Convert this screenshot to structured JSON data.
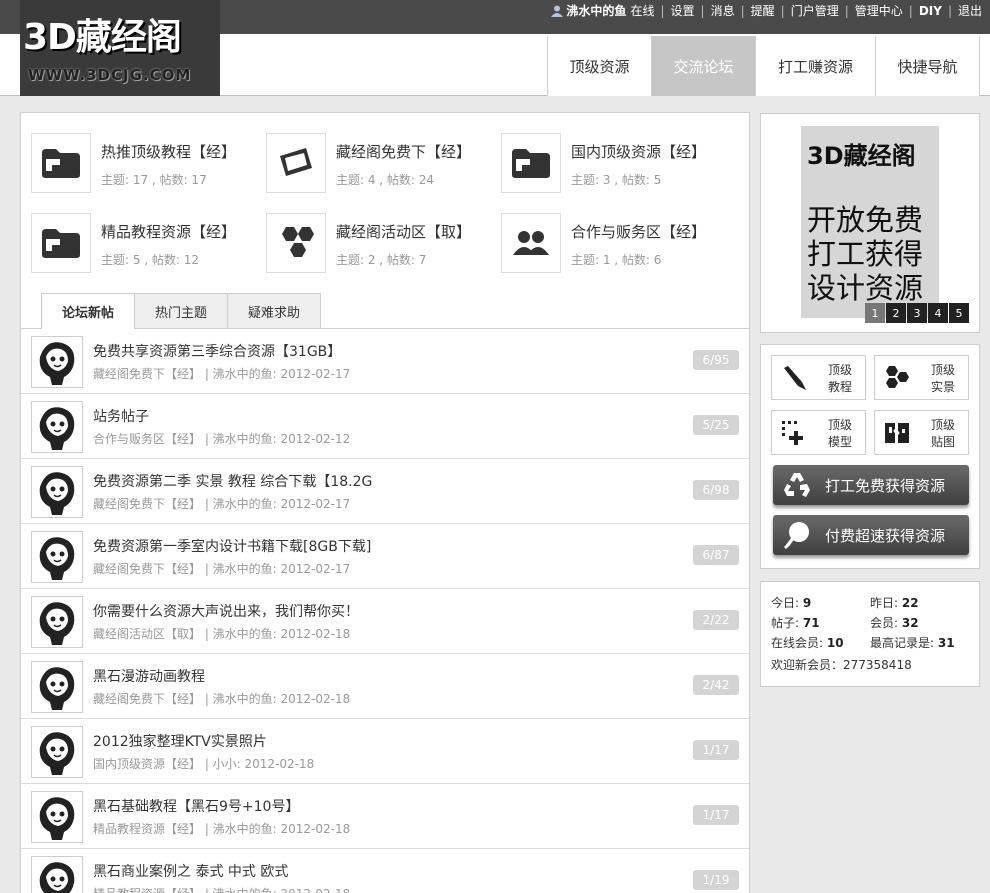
{
  "topbar": {
    "username": "沸水中的鱼",
    "status": "在线",
    "links": [
      "设置",
      "消息",
      "提醒",
      "门户管理",
      "管理中心",
      "DIY",
      "退出"
    ]
  },
  "logo": {
    "main": "3D藏经阁",
    "sub": "WWW.3DCJG.COM"
  },
  "nav": {
    "items": [
      "顶级资源",
      "交流论坛",
      "打工赚资源",
      "快捷导航"
    ],
    "active": "交流论坛"
  },
  "forums": [
    {
      "name": "热推顶级教程【经】",
      "stat": "主题: 17 , 帖数: 17",
      "icon": "folder-icon"
    },
    {
      "name": "藏经阁免费下【经】",
      "stat": "主题: 4 , 帖数: 24",
      "icon": "frames-icon"
    },
    {
      "name": "国内顶级资源【经】",
      "stat": "主题: 3 , 帖数: 5",
      "icon": "folder-icon"
    },
    {
      "name": "精品教程资源【经】",
      "stat": "主题: 5 , 帖数: 12",
      "icon": "folder-icon"
    },
    {
      "name": "藏经阁活动区【取】",
      "stat": "主题: 2 , 帖数: 7",
      "icon": "hexagons-icon"
    },
    {
      "name": "合作与贩务区【经】",
      "stat": "主题: 1 , 帖数: 6",
      "icon": "users-icon"
    }
  ],
  "tabs": [
    "论坛新帖",
    "热门主题",
    "疑难求助"
  ],
  "threads": [
    {
      "title": "免费共享资源第三季综合资源【31GB】",
      "meta": "藏经阁免费下【经】 | 沸水中的鱼: 2012-02-17",
      "count": "6/95"
    },
    {
      "title": "站务帖子",
      "meta": "合作与贩务区【经】 | 沸水中的鱼: 2012-02-12",
      "count": "5/25"
    },
    {
      "title": "免费资源第二季 实景 教程 综合下载【18.2G",
      "meta": "藏经阁免费下【经】 | 沸水中的鱼: 2012-02-17",
      "count": "6/98"
    },
    {
      "title": "免费资源第一季室内设计书籍下载[8GB下载]",
      "meta": "藏经阁免费下【经】 | 沸水中的鱼: 2012-02-17",
      "count": "6/87"
    },
    {
      "title": "你需要什么资源大声说出来，我们帮你买！",
      "meta": "藏经阁活动区【取】 | 沸水中的鱼: 2012-02-18",
      "count": "2/22"
    },
    {
      "title": "黑石漫游动画教程",
      "meta": "藏经阁免费下【经】 | 沸水中的鱼: 2012-02-18",
      "count": "2/42"
    },
    {
      "title": "2012独家整理KTV实景照片",
      "meta": "国内顶级资源【经】 | 小小: 2012-02-18",
      "count": "1/17"
    },
    {
      "title": "黑石基础教程【黑石9号+10号】",
      "meta": "精品教程资源【经】 | 沸水中的鱼: 2012-02-18",
      "count": "1/17"
    },
    {
      "title": "黑石商业案例之 泰式 中式 欧式",
      "meta": "精品教程资源【经】 | 沸水中的鱼: 2012-02-18",
      "count": "1/19"
    }
  ],
  "banner": {
    "title": "3D藏经阁",
    "lines": [
      "开放免费",
      "打工获得",
      "设计资源"
    ],
    "pages": [
      "1",
      "2",
      "3",
      "4",
      "5"
    ]
  },
  "quick": [
    {
      "text": "顶级\n教程",
      "icon": "brush-icon"
    },
    {
      "text": "顶级\n实景",
      "icon": "hexagons-icon"
    },
    {
      "text": "顶级\n模型",
      "icon": "grid-plus-icon"
    },
    {
      "text": "顶级\n贴图",
      "icon": "puzzle-icon"
    }
  ],
  "big_buttons": [
    {
      "text": "打工免费获得资源",
      "icon": "recycle-icon"
    },
    {
      "text": "付费超速获得资源",
      "icon": "pen-icon"
    }
  ],
  "stats": {
    "today_label": "今日:",
    "today": "9",
    "yesterday_label": "昨日:",
    "yesterday": "22",
    "posts_label": "帖子:",
    "posts": "71",
    "members_label": "会员:",
    "members": "32",
    "online_label": "在线会员:",
    "online": "10",
    "record_label": "最高记录是:",
    "record": "31",
    "welcome": "欢迎新会员：277358418"
  }
}
